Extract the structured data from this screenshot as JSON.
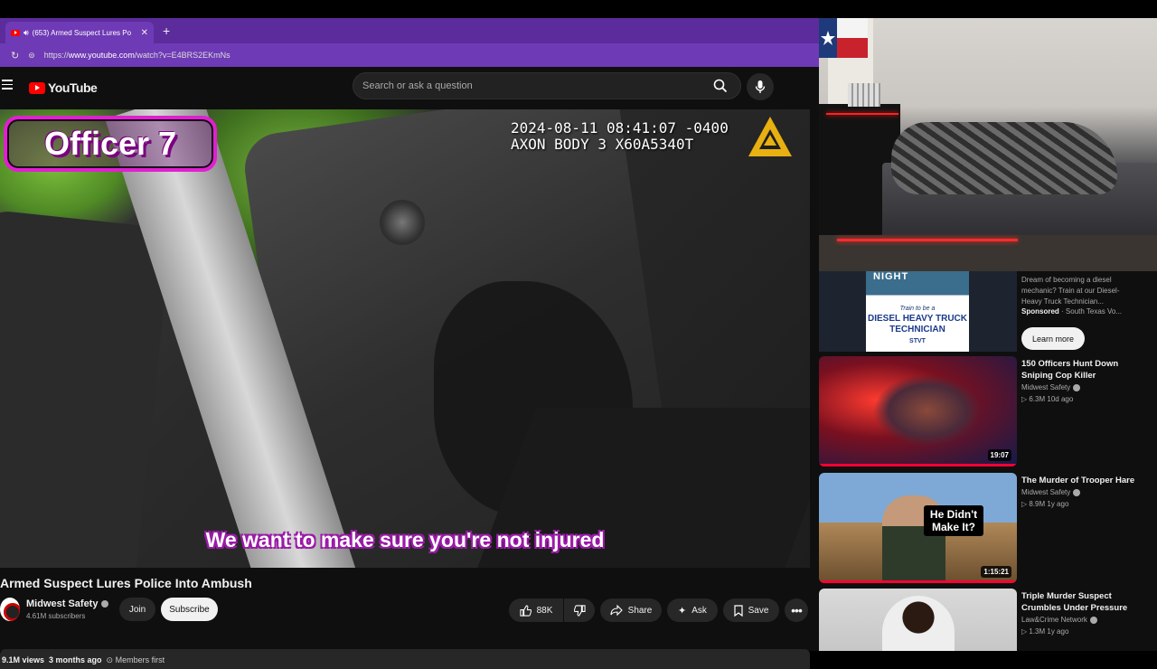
{
  "browser": {
    "tab_title": "(653) Armed Suspect Lures Po",
    "url_prefix": "https://",
    "url_host": "www.youtube.com",
    "url_path": "/watch?v=E4BRS2EKmNs"
  },
  "header": {
    "logo_text": "YouTube",
    "search_placeholder": "Search or ask a question"
  },
  "video": {
    "overlay_badge": "Officer 7",
    "axon_line1": "2024-08-11 08:41:07 -0400",
    "axon_line2": "AXON BODY 3 X60A5340T",
    "subtitle": "We want to make sure you're not injured",
    "title": "Armed Suspect Lures Police Into Ambush"
  },
  "channel": {
    "name": "Midwest Safety",
    "subscribers": "4.61M subscribers",
    "join_label": "Join",
    "subscribe_label": "Subscribe"
  },
  "actions": {
    "likes": "88K",
    "share_label": "Share",
    "ask_label": "Ask",
    "save_label": "Save"
  },
  "meta": {
    "views": "9.1M views",
    "age": "3 months ago",
    "members": "Members first"
  },
  "sidebar": {
    "ad": {
      "thumb_top": "NIGHT",
      "thumb_train": "Train to be a",
      "thumb_headline": "DIESEL HEAVY TRUCK TECHNICIAN",
      "thumb_brand": "STVT",
      "description": "Dream of becoming a diesel mechanic? Train at our Diesel-Heavy Truck Technician...",
      "sponsored": "Sponsored",
      "sponsor_name": "· South Texas Vo...",
      "cta": "Learn more"
    },
    "recs": [
      {
        "title": "150 Officers Hunt Down Sniping Cop Killer",
        "channel": "Midwest Safety",
        "stats": "▷ 6.3M  10d ago",
        "duration": "19:07"
      },
      {
        "title": "The Murder of Trooper Hare",
        "channel": "Midwest Safety",
        "stats": "▷ 8.9M  1y ago",
        "duration": "1:15:21",
        "thumb_text": "He Didn't Make It?"
      },
      {
        "title": "Triple Murder Suspect Crumbles Under Pressure",
        "channel": "Law&Crime Network",
        "stats": "▷ 1.3M  1y ago"
      }
    ]
  },
  "colors": {
    "browser_chrome": "#5c2c9c",
    "tab_active": "#6e3ab5",
    "overlay_magenta": "#e020d0",
    "yt_red": "#ff0000",
    "progress_red": "#ff0033"
  }
}
